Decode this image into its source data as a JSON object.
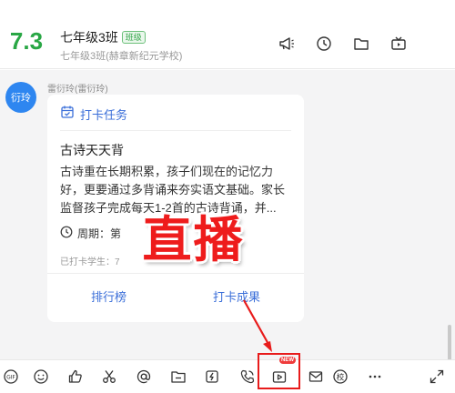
{
  "header": {
    "avatar_text": "7.3",
    "group_name": "七年级3班",
    "group_tag": "班级",
    "group_subtitle": "七年级3班(赫章新纪元学校)"
  },
  "chat": {
    "sender_avatar_text": "衍玲",
    "sender_name": "雷衍玲(雷衍玲)",
    "card": {
      "head_label": "打卡任务",
      "title": "古诗天天背",
      "body": "古诗重在长期积累，孩子们现在的记忆力好，更要通过多背诵来夯实语文基础。家长监督孩子完成每天1-2首的古诗背诵，并...",
      "period_label": "周期：第",
      "sub_text": "已打卡学生：7",
      "btn_rank": "排行榜",
      "btn_result": "打卡成果"
    }
  },
  "overlay": {
    "live_text": "直播"
  },
  "toolbar": {
    "new_badge": "NEW",
    "icons": [
      "sticker-icon",
      "emoji-icon",
      "like-icon",
      "scissors-icon",
      "mention-icon",
      "folder-icon",
      "flash-icon",
      "call-icon",
      "live-icon",
      "mail-icon",
      "school-icon",
      "more-icon",
      "expand-icon"
    ]
  },
  "colors": {
    "accent_blue": "#3b6fd9",
    "group_green": "#29a745",
    "annotation_red": "#e81b1b"
  }
}
